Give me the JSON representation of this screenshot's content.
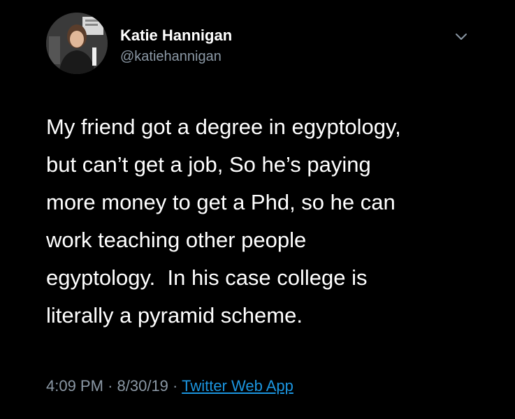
{
  "tweet": {
    "author": {
      "name": "Katie Hannigan",
      "handle": "@katiehannigan"
    },
    "body_lines": [
      "My friend got a degree in egyptology,",
      "but can’t get a job, So he’s paying",
      "more money to get a Phd, so he can",
      "work teaching other people",
      "egyptology.  In his case college is",
      "literally a pyramid scheme."
    ],
    "time": "4:09 PM",
    "separator": "·",
    "date": "8/30/19",
    "source": "Twitter Web App"
  },
  "icons": {
    "menu": "chevron-down-icon"
  },
  "colors": {
    "background": "#000000",
    "text": "#ffffff",
    "secondary": "#8b98a5",
    "link": "#1b95e0"
  }
}
